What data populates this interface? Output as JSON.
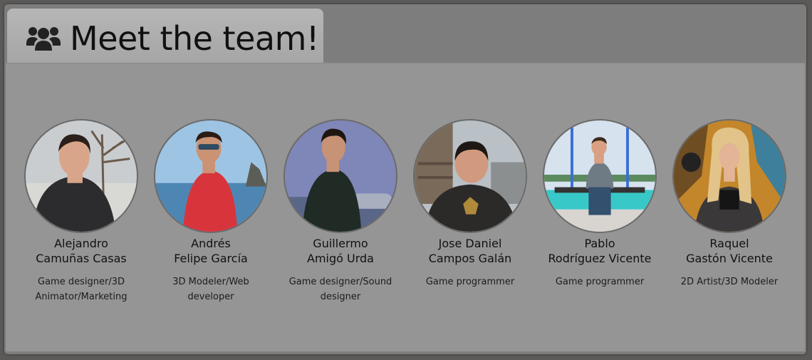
{
  "header": {
    "title": "Meet the team!",
    "icon": "users-icon"
  },
  "members": [
    {
      "name": "Alejandro\nCamuñas Casas",
      "role": "Game designer/3D Animator/Marketing"
    },
    {
      "name": "Andrés\nFelipe García",
      "role": "3D Modeler/Web developer"
    },
    {
      "name": "Guillermo\nAmigó Urda",
      "role": "Game designer/Sound designer"
    },
    {
      "name": "Jose Daniel\nCampos Galán",
      "role": "Game programmer"
    },
    {
      "name": "Pablo\nRodríguez Vicente",
      "role": "Game programmer"
    },
    {
      "name": "Raquel\nGastón Vicente",
      "role": "2D Artist/3D Modeler"
    }
  ],
  "colors": {
    "background": "#5c5a58",
    "window": "#7d7d7d",
    "panel": "#959595",
    "tab": "#b0b0b0"
  }
}
